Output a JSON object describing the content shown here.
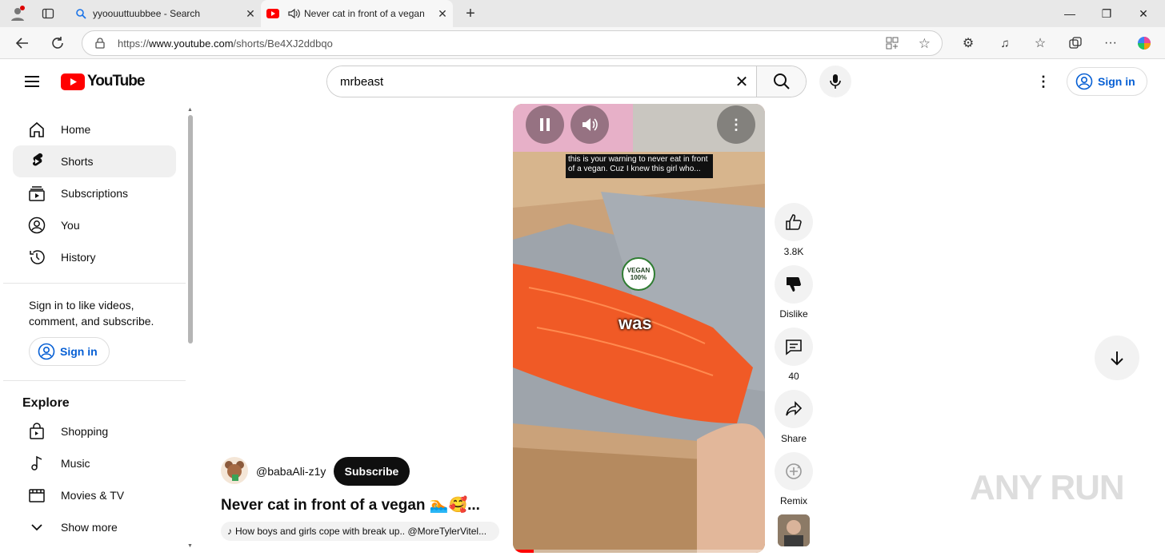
{
  "browser": {
    "tabs": [
      {
        "title": "yyoouuttuubbee - Search"
      },
      {
        "title": "Never cat in front of a vegan"
      }
    ],
    "url_prefix": "https://",
    "url_domain": "www.youtube.com",
    "url_path": "/shorts/Be4XJ2ddbqo"
  },
  "header": {
    "logo_text": "YouTube",
    "search_value": "mrbeast",
    "signin_label": "Sign in"
  },
  "sidebar": {
    "items": [
      {
        "label": "Home",
        "icon": "home-icon"
      },
      {
        "label": "Shorts",
        "icon": "shorts-icon"
      },
      {
        "label": "Subscriptions",
        "icon": "subscriptions-icon"
      },
      {
        "label": "You",
        "icon": "you-icon"
      },
      {
        "label": "History",
        "icon": "history-icon"
      }
    ],
    "signin_prompt": "Sign in to like videos, comment, and subscribe.",
    "signin_label": "Sign in",
    "explore_heading": "Explore",
    "explore_items": [
      {
        "label": "Shopping",
        "icon": "shopping-icon"
      },
      {
        "label": "Music",
        "icon": "music-icon"
      },
      {
        "label": "Movies & TV",
        "icon": "movies-icon"
      },
      {
        "label": "Show more",
        "icon": "chevron-down-icon"
      }
    ]
  },
  "short": {
    "channel": "@babaAli-z1y",
    "subscribe_label": "Subscribe",
    "title": "Never cat in front of a vegan 🏊🥰...",
    "sound": "How boys and girls cope with break up.. @MoreTylerVitel...",
    "caption_top": "this is your warning to never eat in front of a vegan. Cuz I knew this girl who...",
    "caption_word": "was",
    "badge": "VEGAN 100%"
  },
  "actions": {
    "like_count": "3.8K",
    "dislike_label": "Dislike",
    "comment_count": "40",
    "share_label": "Share",
    "remix_label": "Remix"
  },
  "watermark": "ANY RUN",
  "colors": {
    "accent": "#065fd4",
    "youtube_red": "#ff0000"
  }
}
